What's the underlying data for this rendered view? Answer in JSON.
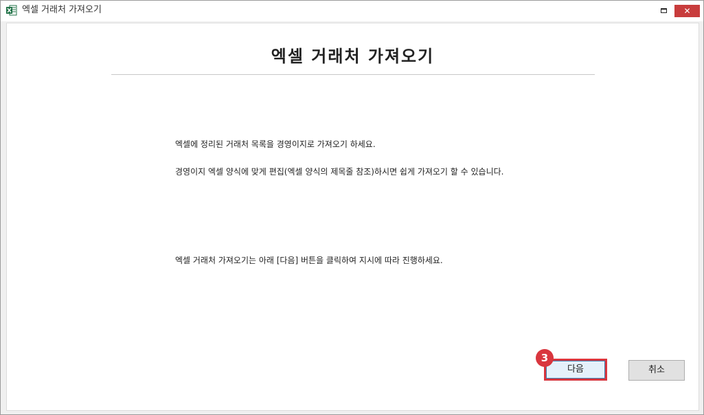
{
  "window": {
    "title": "엑셀 거래처 가져오기",
    "icon": "excel-icon",
    "controls": {
      "maximize": "maximize-icon",
      "close": "close-icon",
      "close_glyph": "✕"
    }
  },
  "main": {
    "heading": "엑셀 거래처 가져오기",
    "messages": [
      "엑셀에 정리된 거래처 목록을 경영이지로 가져오기 하세요.",
      "경영이지 엑셀 양식에 맞게 편집(엑셀 양식의 제목줄 참조)하시면 쉽게 가져오기 할 수 있습니다.",
      "엑셀 거래처 가져오기는 아래 [다음] 버튼을 클릭하여 지시에 따라 진행하세요."
    ]
  },
  "footer": {
    "next_label": "다음",
    "cancel_label": "취소",
    "step_badge": "3"
  },
  "colors": {
    "highlight": "#d9363e",
    "close_button": "#c83c3c",
    "excel_green": "#1e7145"
  }
}
